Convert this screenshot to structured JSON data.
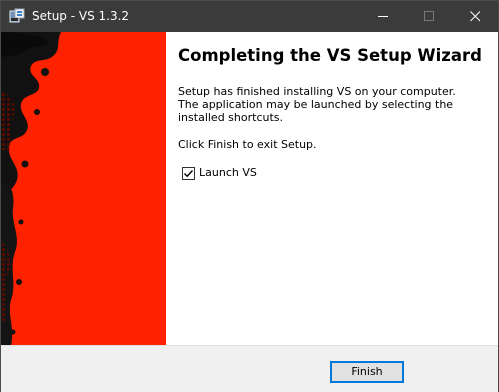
{
  "window": {
    "title": "Setup - VS 1.3.2"
  },
  "titlebar": {
    "icons": [
      "installer-app-icon",
      "minimize-icon",
      "maximize-icon",
      "close-icon"
    ]
  },
  "banner": {
    "background_color": "#ff2200",
    "artwork_color": "#111111"
  },
  "main": {
    "heading": "Completing the VS Setup Wizard",
    "paragraph": "Setup has finished installing VS on your computer. The application may be launched by selecting the installed shortcuts.",
    "exit_note": "Click Finish to exit Setup.",
    "launch_checkbox": {
      "label": "Launch VS",
      "checked": true
    }
  },
  "footer": {
    "finish_label": "Finish"
  },
  "colors": {
    "titlebar_bg": "#3b3b3b",
    "footer_bg": "#f0f0f0",
    "accent": "#0078d7"
  }
}
